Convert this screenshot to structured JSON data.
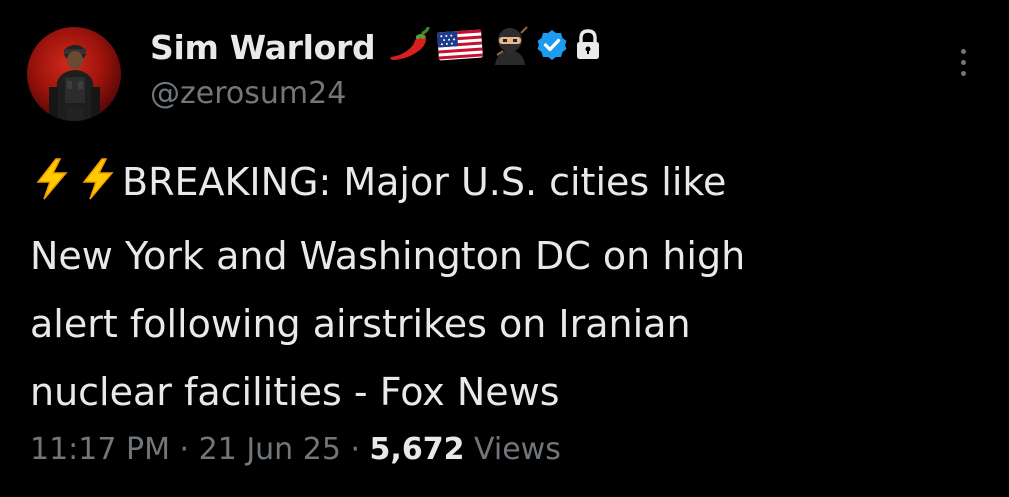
{
  "author": {
    "display_name": "Sim Warlord",
    "handle": "@zerosum24",
    "name_emojis": [
      "chili-pepper-icon",
      "us-flag-icon",
      "ninja-icon",
      "verified-badge-icon",
      "lock-icon"
    ]
  },
  "tweet": {
    "lines": [
      "BREAKING: Major U.S. cities like",
      "New York and Washington DC on high",
      "alert following airstrikes on Iranian",
      "nuclear facilities - Fox News"
    ],
    "leading_emojis": [
      "lightning-icon",
      "lightning-icon"
    ]
  },
  "meta": {
    "time": "11:17 PM",
    "separator": "·",
    "date": "21 Jun 25",
    "views_count": "5,672",
    "views_label": "Views"
  },
  "colors": {
    "background": "#000000",
    "primary_text": "#e7e9ea",
    "secondary_text": "#71767b",
    "verified": "#1d9bf0",
    "lightning": "#ffcc00"
  }
}
